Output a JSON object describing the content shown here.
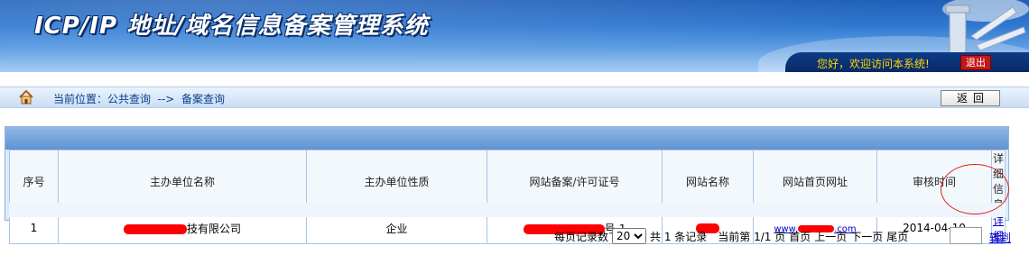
{
  "header": {
    "title": "ICP/IP 地址/域名信息备案管理系统",
    "welcome": "您好，欢迎访问本系统!",
    "logout_label": "退出"
  },
  "breadcrumb": {
    "text": "当前位置：公共查询  -->  备案查询",
    "back_label": "返回"
  },
  "table": {
    "columns": [
      "序号",
      "主办单位名称",
      "主办单位性质",
      "网站备案/许可证号",
      "网站名称",
      "网站首页网址",
      "审核时间",
      "详细信息"
    ],
    "rows": [
      {
        "index": "1",
        "org_name_visible": "技有限公司",
        "org_type": "企业",
        "license_visible": "号-1",
        "site_name_visible": "",
        "url_visible": "www.",
        "url_suffix": ".com",
        "audit_date": "2014-04-10",
        "detail_label": "详细"
      }
    ]
  },
  "pagination": {
    "per_page_label": "每页记录数",
    "per_page_value": "20",
    "total_text": "共 1 条记录",
    "current_text": "当前第 1/1 页",
    "first": "首页",
    "prev": "上一页",
    "next": "下一页",
    "last": "尾页",
    "goto_label": "转到"
  },
  "colors": {
    "banner": "#2f78d0",
    "redaction": "#ff0000",
    "link": "#0000cc",
    "welcome_text": "#ffd700"
  }
}
